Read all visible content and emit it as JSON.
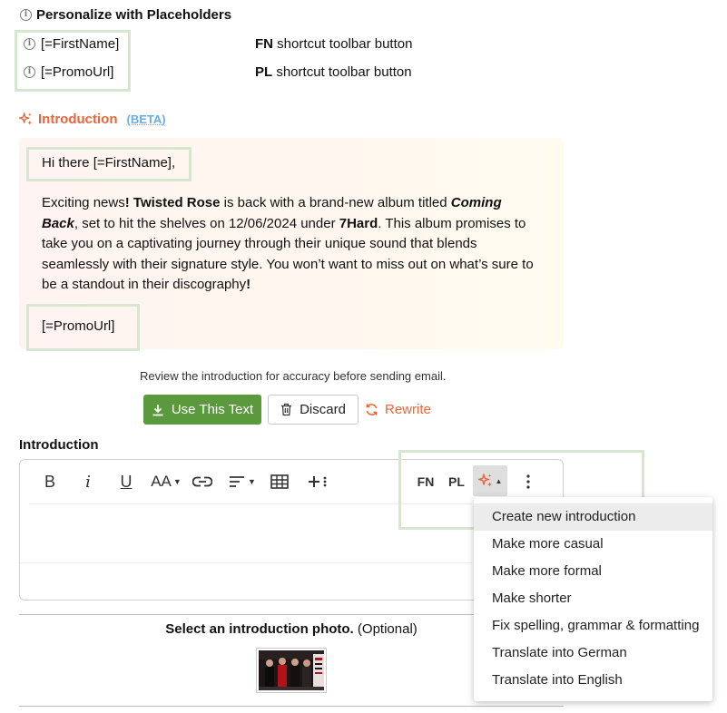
{
  "placeholders": {
    "title": "Personalize with Placeholders",
    "items": [
      {
        "token": "[=FirstName]",
        "shortcut": "FN",
        "description": "shortcut toolbar button"
      },
      {
        "token": "[=PromoUrl]",
        "shortcut": "PL",
        "description": "shortcut toolbar button"
      }
    ]
  },
  "ai_intro": {
    "title": "Introduction",
    "badge": "(BETA)",
    "greeting": "Hi there [=FirstName],",
    "body": {
      "p1": "Exciting news",
      "bang1": "!",
      "band": "Twisted Rose",
      "p2": "is back with a brand-new album titled",
      "album": "Coming Back",
      "p3": ", set to hit the shelves on 12/06/2024 under",
      "label": "7Hard",
      "p4": ". This album promises to take you on a captivating journey through their unique sound that blends seamlessly with their signature style. You won’t want to miss out on what’s sure to be a standout in their discography",
      "bang2": "!"
    },
    "promo": "[=PromoUrl]",
    "review_note": "Review the introduction for accuracy before sending email.",
    "use_label": "Use This Text",
    "discard_label": "Discard",
    "rewrite_label": "Rewrite"
  },
  "editor": {
    "label": "Introduction",
    "toolbar": {
      "bold": "B",
      "italic": "i",
      "underline": "U",
      "font_size": "AA",
      "fn": "FN",
      "pl": "PL"
    }
  },
  "ai_menu": {
    "items": [
      "Create new introduction",
      "Make more casual",
      "Make more formal",
      "Make shorter",
      "Fix spelling, grammar & formatting",
      "Translate into German",
      "Translate into English"
    ],
    "active_index": 0
  },
  "photo": {
    "label_bold": "Select an introduction photo.",
    "label_optional": "(Optional)"
  },
  "colors": {
    "accent_orange": "#e8663a",
    "green_button": "#5a9a3d",
    "beta_blue": "#6aaee0",
    "highlight_green": "#d5e8cf"
  }
}
